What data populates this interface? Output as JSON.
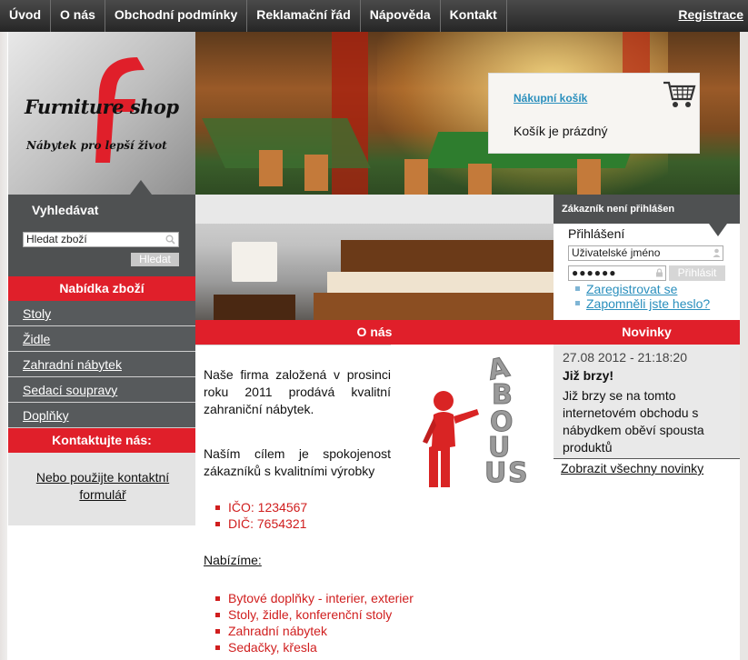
{
  "nav": {
    "items": [
      "Úvod",
      "O nás",
      "Obchodní podmínky",
      "Reklamační řád",
      "Nápověda",
      "Kontakt"
    ],
    "register": "Registrace"
  },
  "brand": {
    "name": "Furniture shop",
    "tagline": "Nábytek pro lepší život",
    "logo_color": "#e01f2a"
  },
  "cart": {
    "title": "Nákupní košík",
    "status": "Košík je prázdný"
  },
  "search": {
    "title": "Vyhledávat",
    "placeholder": "Hledat zboží",
    "button": "Hledat"
  },
  "sidebar": {
    "offer_title": "Nabídka zboží",
    "categories": [
      "Stoly",
      "Židle",
      "Zahradní nábytek",
      "Sedací soupravy",
      "Doplňky"
    ],
    "contact_title": "Kontaktujte nás:",
    "contact_link": "Nebo použijte kontaktní formulář"
  },
  "about": {
    "heading": "O nás",
    "para1": "Naše firma založená v prosinci roku 2011 prodává kvalitní zahraniční nábytek.",
    "para2": "Naším cílem je spokojenost zákazníků s kvalitními výrobky",
    "ids": [
      "IČO: 1234567",
      "DIČ: 7654321"
    ],
    "offer_label": "Nabízíme:",
    "offers": [
      "Bytové doplňky - interier, exterier",
      "Stoly, židle, konferenční stoly",
      "Zahradní nábytek",
      "Sedačky, křesla"
    ],
    "image_text": "ABOUT US"
  },
  "customer": {
    "status": "Zákazník není přihlášen",
    "login_title": "Přihlášení",
    "username_placeholder": "Uživatelské jméno",
    "password_value": "●●●●●●",
    "login_button": "Přihlásit",
    "links": [
      "Zaregistrovat se",
      "Zapomněli jste heslo?"
    ]
  },
  "news": {
    "heading": "Novinky",
    "date": "27.08 2012 - 21:18:20",
    "title": "Již brzy!",
    "body": "Již brzy se na tomto internetovém obchodu s nábydkem oběví spousta produktů",
    "all_link": "Zobrazit všechny novinky"
  },
  "colors": {
    "accent_red": "#e01f2a",
    "dark_panel": "#4f5152",
    "link_blue": "#2a8fbd"
  }
}
